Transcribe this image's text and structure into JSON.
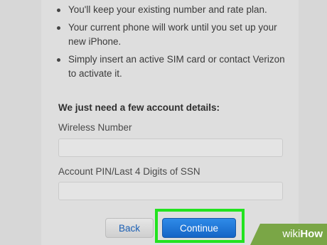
{
  "bullets": [
    "You'll keep your existing number and rate plan.",
    "Your current phone will work until you set up your new iPhone.",
    "Simply insert an active SIM card or contact Verizon to activate it."
  ],
  "form": {
    "heading": "We just need a few account details:",
    "wireless_label": "Wireless Number",
    "wireless_value": "",
    "pin_label": "Account PIN/Last 4 Digits of SSN",
    "pin_value": ""
  },
  "buttons": {
    "back": "Back",
    "continue": "Continue"
  },
  "watermark": {
    "wiki": "wiki",
    "how": "How"
  }
}
